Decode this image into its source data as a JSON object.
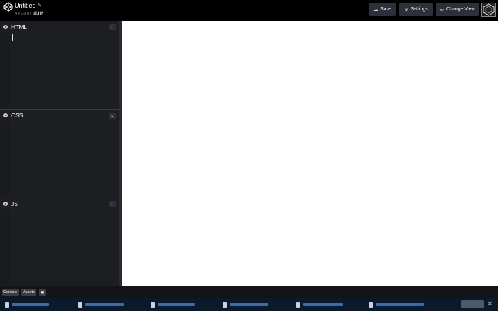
{
  "header": {
    "title": "Untitled",
    "byline_prefix": "A PEN BY",
    "author": "최대한",
    "save_label": "Save",
    "settings_label": "Settings",
    "change_view_label": "Change View"
  },
  "editors": {
    "html_label": "HTML",
    "css_label": "CSS",
    "js_label": "JS",
    "line_number": "1"
  },
  "footer": {
    "console_label": "Console",
    "assets_label": "Assets",
    "close_label": "✖"
  },
  "taskbar": {
    "more_label": "…",
    "close_label": "✕"
  },
  "colors": {
    "header_bg": "#000000",
    "editor_bg": "#1d1e22",
    "button_bg": "#2c303a",
    "preview_bg": "#ffffff",
    "taskbar_bg": "#0b1a2b"
  },
  "icons": [
    "codepen-logo-icon",
    "pencil-icon",
    "cloud-icon",
    "gear-icon",
    "layout-icon",
    "chevron-down-icon",
    "document-icon",
    "close-icon"
  ]
}
